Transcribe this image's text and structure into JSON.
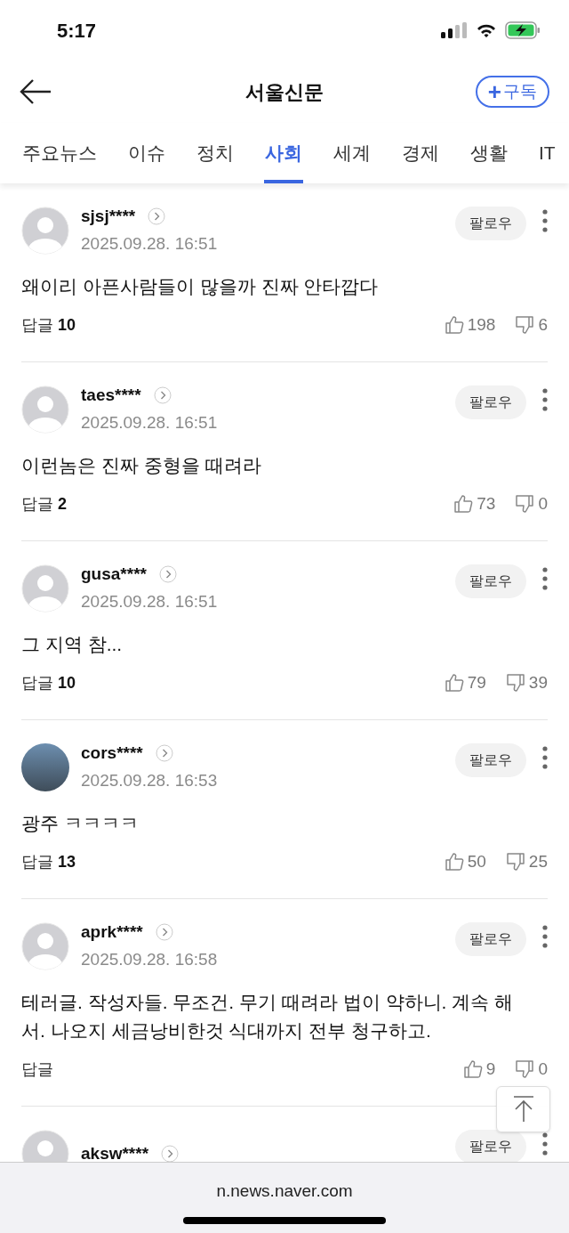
{
  "status_bar": {
    "time": "5:17"
  },
  "header": {
    "title": "서울신문",
    "subscribe": {
      "icon": "+",
      "label": "구독"
    }
  },
  "tabs": [
    {
      "label": "주요뉴스",
      "selected": false
    },
    {
      "label": "이슈",
      "selected": false
    },
    {
      "label": "정치",
      "selected": false
    },
    {
      "label": "사회",
      "selected": true
    },
    {
      "label": "세계",
      "selected": false
    },
    {
      "label": "경제",
      "selected": false
    },
    {
      "label": "생활",
      "selected": false
    },
    {
      "label": "IT",
      "selected": false
    }
  ],
  "comments": [
    {
      "avatar": {
        "kind": "default"
      },
      "user": "sjsj****",
      "date": "2025.09.28. 16:51",
      "follow": "팔로우",
      "text": "왜이리 아픈사람들이 많을까 진짜 안타깝다",
      "reply_label": "답글",
      "reply_count": "10",
      "likes": "198",
      "dislikes": "6"
    },
    {
      "avatar": {
        "kind": "default"
      },
      "user": "taes****",
      "date": "2025.09.28. 16:51",
      "follow": "팔로우",
      "text": "이런놈은 진짜 중형을 때려라",
      "reply_label": "답글",
      "reply_count": "2",
      "likes": "73",
      "dislikes": "0"
    },
    {
      "avatar": {
        "kind": "default"
      },
      "user": "gusa****",
      "date": "2025.09.28. 16:51",
      "follow": "팔로우",
      "text": "그 지역 참...",
      "reply_label": "답글",
      "reply_count": "10",
      "likes": "79",
      "dislikes": "39"
    },
    {
      "avatar": {
        "kind": "photo"
      },
      "user": "cors****",
      "date": "2025.09.28. 16:53",
      "follow": "팔로우",
      "text": "광주 ㅋㅋㅋㅋ",
      "reply_label": "답글",
      "reply_count": "13",
      "likes": "50",
      "dislikes": "25"
    },
    {
      "avatar": {
        "kind": "default"
      },
      "user": "aprk****",
      "date": "2025.09.28. 16:58",
      "follow": "팔로우",
      "text": "테러글. 작성자들. 무조건. 무기 때려라 법이 약하니. 계속 해서. 나오지 세금낭비한것 식대까지 전부 청구하고.",
      "reply_label": "답글",
      "likes": "9",
      "dislikes": "0"
    },
    {
      "avatar": {
        "kind": "default"
      },
      "user": "aksw****",
      "follow": "팔로우"
    }
  ],
  "bottom_bar": {
    "url": "n.news.naver.com"
  }
}
